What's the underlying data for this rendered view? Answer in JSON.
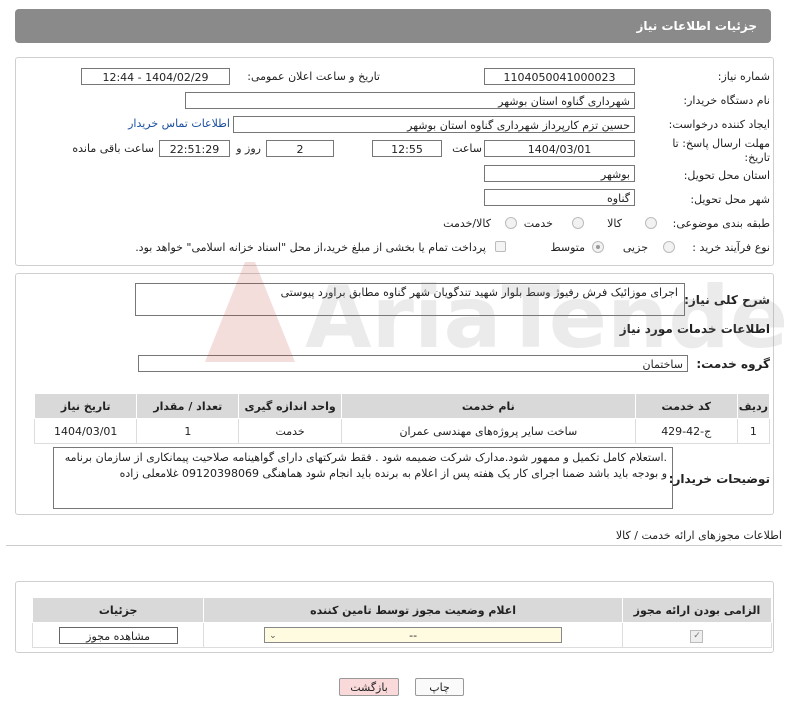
{
  "header": {
    "title": "جزئیات اطلاعات نیاز"
  },
  "form": {
    "need_number_label": "شماره نیاز:",
    "need_number": "1104050041000023",
    "announce_label": "تاریخ و ساعت اعلان عمومی:",
    "announce_value": "1404/02/29 - 12:44",
    "buyer_org_label": "نام دستگاه خریدار:",
    "buyer_org": "شهرداری گناوه استان بوشهر",
    "creator_label": "ایجاد کننده درخواست:",
    "creator": "حسین تزم کارپرداز شهرداری گناوه استان بوشهر",
    "contact_link": "اطلاعات تماس خریدار",
    "deadline_label_1": "مهلت ارسال پاسخ: تا",
    "deadline_label_2": "تاریخ:",
    "deadline_date": "1404/03/01",
    "time_label": "ساعت",
    "deadline_time": "12:55",
    "days_value": "2",
    "days_label": "روز و",
    "remaining_value": "22:51:29",
    "remaining_label": "ساعت باقی مانده",
    "province_label": "استان محل تحویل:",
    "province": "بوشهر",
    "city_label": "شهر محل تحویل:",
    "city": "گناوه",
    "category_label": "طبقه بندی موضوعی:",
    "category_options": [
      "کالا",
      "خدمت",
      "کالا/خدمت"
    ],
    "process_label": "نوع فرآیند خرید :",
    "process_options": [
      "جزیی",
      "متوسط"
    ],
    "payment_note": "پرداخت تمام یا بخشی از مبلغ خرید،از محل \"اسناد خزانه اسلامی\" خواهد بود."
  },
  "summary": {
    "label": "شرح کلی نیاز:",
    "text": "اجرای موزائیک فرش رفیوژ وسط بلوار شهید تندگویان شهر گناوه مطابق براورد پیوستی"
  },
  "services": {
    "title": "اطلاعات خدمات مورد نیاز",
    "group_label": "گروه خدمت:",
    "group_value": "ساختمان",
    "columns": [
      "ردیف",
      "کد خدمت",
      "نام خدمت",
      "واحد اندازه گیری",
      "تعداد / مقدار",
      "تاریخ نیاز"
    ],
    "rows": [
      [
        "1",
        "ج-42-429",
        "ساخت سایر پروژه‌های مهندسی عمران",
        "خدمت",
        "1",
        "1404/03/01"
      ]
    ]
  },
  "buyer_notes": {
    "label": "توضیحات خریدار:",
    "text": ".استعلام کامل تکمیل و ممهور شود.مدارک شرکت ضمیمه شود . فقط شرکتهای دارای گواهینامه صلاحیت پیمانکاری از سازمان برنامه و بودجه باید باشد ضمنا اجرای کار یک هفته پس از اعلام به برنده باید انجام شود هماهنگی 09120398069 غلامعلی زاده"
  },
  "permits": {
    "title": "اطلاعات مجوزهای ارائه خدمت / کالا",
    "columns": [
      "الزامی بودن ارائه مجوز",
      "اعلام وضعیت مجوز توسط تامین کننده",
      "جزئیات"
    ],
    "select_value": "--",
    "view_button": "مشاهده مجوز"
  },
  "footer": {
    "print_button": "چاپ",
    "back_button": "بازگشت"
  },
  "watermark": "AriaTender.neT",
  "colors": {
    "header_bg": "#8a8a8a",
    "link": "#1a4fa0",
    "back_btn_bg": "#f9d9d9",
    "select_bg": "#fffbe0"
  }
}
